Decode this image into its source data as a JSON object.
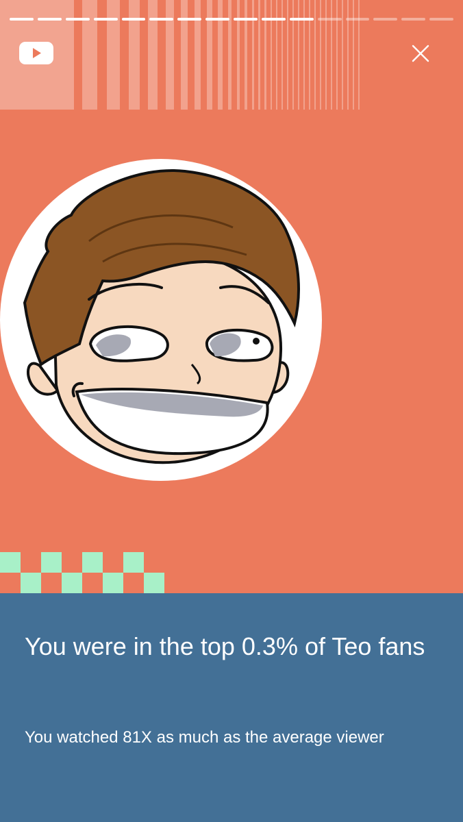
{
  "header": {
    "logo_icon": "youtube-play-icon",
    "close_icon": "close-icon",
    "progress": {
      "segments_total": 16,
      "segments_complete": 11
    }
  },
  "hero": {
    "avatar": "cartoon-avatar-teo",
    "checker_color": "#a8f0c8"
  },
  "info": {
    "headline": "You were in the top 0.3% of Teo fans",
    "subtext": "You watched 81X as much as the average viewer"
  },
  "colors": {
    "background": "#ec7a5c",
    "panel": "#437096",
    "text": "#ffffff"
  }
}
